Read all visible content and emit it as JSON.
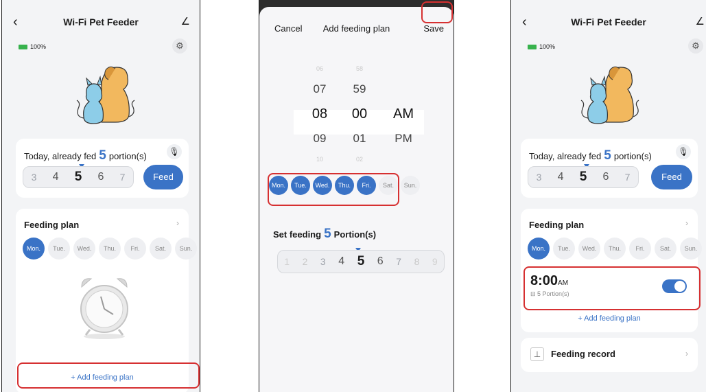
{
  "screen1": {
    "back_icon": "‹",
    "title": "Wi-Fi Pet Feeder",
    "edit_icon": "∠",
    "battery": "100%",
    "gear_icon": "⚙",
    "fed": {
      "prefix": "Today, already fed",
      "count": "5",
      "suffix": "portion(s)"
    },
    "mic_icon": "🎙",
    "portions": [
      "3",
      "4",
      "5",
      "6",
      "7"
    ],
    "feed_button": "Feed",
    "plan_title": "Feeding plan",
    "chevron": "›",
    "days": [
      "Mon.",
      "Tue.",
      "Wed.",
      "Thu.",
      "Fri.",
      "Sat.",
      "Sun."
    ],
    "add_plan": "+ Add feeding plan"
  },
  "screen2": {
    "cancel": "Cancel",
    "title": "Add feeding plan",
    "save": "Save",
    "hours": [
      "06",
      "07",
      "08",
      "09",
      "10"
    ],
    "minutes": [
      "58",
      "59",
      "00",
      "01",
      "02"
    ],
    "ampm": [
      "AM",
      "PM"
    ],
    "days": [
      "Mon.",
      "Tue.",
      "Wed.",
      "Thu.",
      "Fri.",
      "Sat.",
      "Sun."
    ],
    "set_prefix": "Set feeding",
    "set_count": "5",
    "set_suffix": "Portion(s)",
    "portions": [
      "1",
      "2",
      "3",
      "4",
      "5",
      "6",
      "7",
      "8",
      "9"
    ]
  },
  "screen3": {
    "back_icon": "‹",
    "title": "Wi-Fi Pet Feeder",
    "edit_icon": "∠",
    "battery": "100%",
    "gear_icon": "⚙",
    "fed": {
      "prefix": "Today, already fed",
      "count": "5",
      "suffix": "portion(s)"
    },
    "mic_icon": "🎙",
    "portions": [
      "3",
      "4",
      "5",
      "6",
      "7"
    ],
    "feed_button": "Feed",
    "plan_title": "Feeding plan",
    "chevron": "›",
    "days": [
      "Mon.",
      "Tue.",
      "Wed.",
      "Thu.",
      "Fri.",
      "Sat.",
      "Sun."
    ],
    "entry_time": "8:00",
    "entry_ampm": "AM",
    "entry_portions": "⊟ 5 Portion(s)",
    "toggle_on": true,
    "add_plan": "+ Add feeding plan",
    "record_icon": "⊥",
    "record": "Feeding record"
  }
}
